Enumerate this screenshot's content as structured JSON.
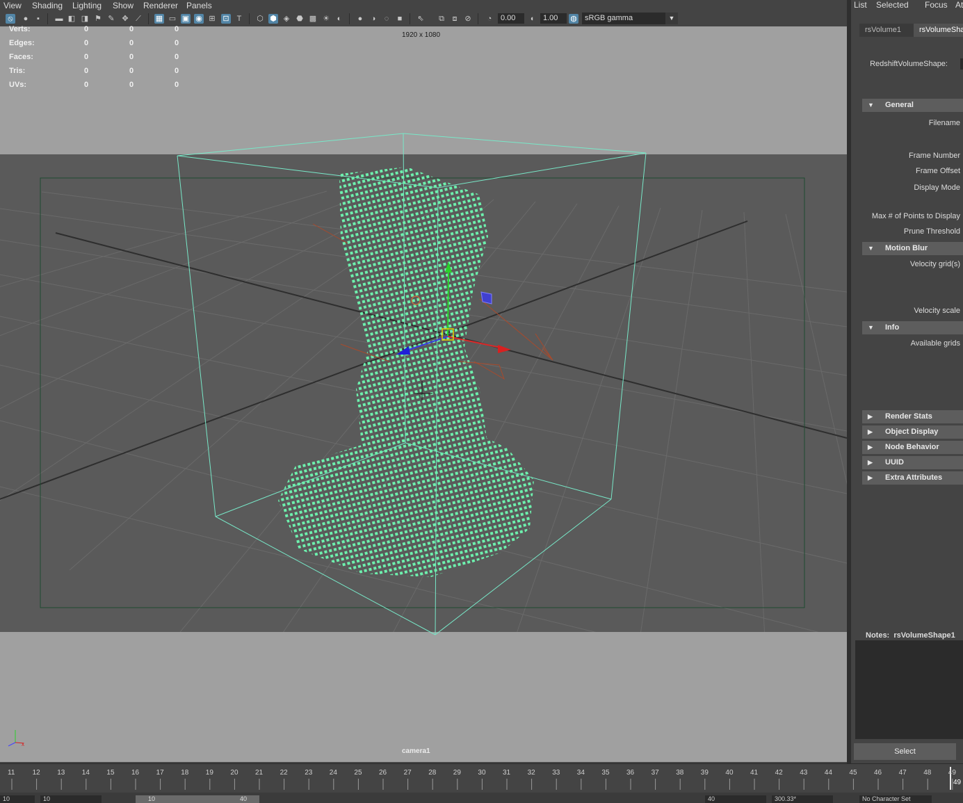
{
  "menu": [
    "View",
    "Shading",
    "Lighting",
    "Show",
    "Renderer",
    "Panels"
  ],
  "toolbar": {
    "exposure": "0.00",
    "gamma": "1.00",
    "color_space": "sRGB gamma"
  },
  "hud": {
    "rows": [
      {
        "label": "Verts:",
        "a": "0",
        "b": "0",
        "c": "0"
      },
      {
        "label": "Edges:",
        "a": "0",
        "b": "0",
        "c": "0"
      },
      {
        "label": "Faces:",
        "a": "0",
        "b": "0",
        "c": "0"
      },
      {
        "label": "Tris:",
        "a": "0",
        "b": "0",
        "c": "0"
      },
      {
        "label": "UVs:",
        "a": "0",
        "b": "0",
        "c": "0"
      }
    ],
    "resolution": "1920 x 1080",
    "camera": "camera1"
  },
  "attr_editor": {
    "menu": [
      "List",
      "Selected",
      "Focus",
      "Att"
    ],
    "tabs": [
      "rsVolume1",
      "rsVolumeSha"
    ],
    "node_type_label": "RedshiftVolumeShape:",
    "sections": {
      "general": "General",
      "motion_blur": "Motion Blur",
      "info": "Info",
      "collapsed": [
        "Render Stats",
        "Object Display",
        "Node Behavior",
        "UUID",
        "Extra Attributes"
      ]
    },
    "general_attrs": [
      "Filename",
      "Frame Number",
      "Frame Offset",
      "Display Mode",
      "Max # of Points to Display",
      "Prune Threshold"
    ],
    "motion_blur_attrs": [
      "Velocity grid(s)",
      "Velocity scale"
    ],
    "info_attrs": [
      "Available grids"
    ],
    "notes_label": "Notes:  rsVolumeShape1",
    "select_button": "Select"
  },
  "timeline": {
    "frames": [
      "11",
      "12",
      "13",
      "14",
      "15",
      "16",
      "17",
      "18",
      "19",
      "20",
      "21",
      "22",
      "23",
      "24",
      "25",
      "26",
      "27",
      "28",
      "29",
      "30",
      "31",
      "32",
      "33",
      "34",
      "35",
      "36",
      "37",
      "38",
      "39",
      "40",
      "41",
      "42",
      "43",
      "44",
      "45",
      "46",
      "47",
      "48",
      "49"
    ],
    "current_frame": "49"
  },
  "range_bar": {
    "start": "10",
    "range_start": "10",
    "range_end": "40",
    "end": "40",
    "fps": "300.33*",
    "character_set": "No Character Set"
  },
  "colors": {
    "voxel": "#6df0ad",
    "bbox": "#78e8c8",
    "grid": "#3c3c3c",
    "accent": "#5285a6"
  }
}
